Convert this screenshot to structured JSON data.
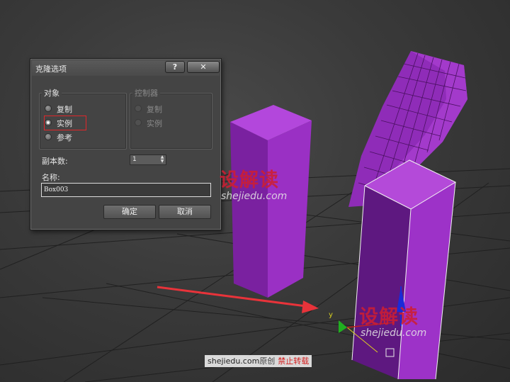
{
  "dialog": {
    "title": "克隆选项",
    "help_label": "?",
    "close_label": "✕",
    "object_group": {
      "label": "对象",
      "options": [
        "复制",
        "实例",
        "参考"
      ],
      "selected": "实例"
    },
    "controller_group": {
      "label": "控制器",
      "options": [
        "复制",
        "实例"
      ],
      "selected": "复制"
    },
    "copies": {
      "label": "副本数:",
      "value": "1"
    },
    "name": {
      "label": "名称:",
      "value": "Box003"
    },
    "ok_label": "确定",
    "cancel_label": "取消"
  },
  "watermark": {
    "cn": "设解读",
    "en": "shejiedu.com"
  },
  "credit": {
    "site": "shejiedu.com",
    "original": "原创",
    "notice": "禁止转载"
  },
  "gizmo": {
    "y_label": "y"
  },
  "colors": {
    "object": "#a336c9",
    "object_dark": "#6e1c8e",
    "highlight": "#e0262a",
    "arrow": "#e8333a"
  }
}
